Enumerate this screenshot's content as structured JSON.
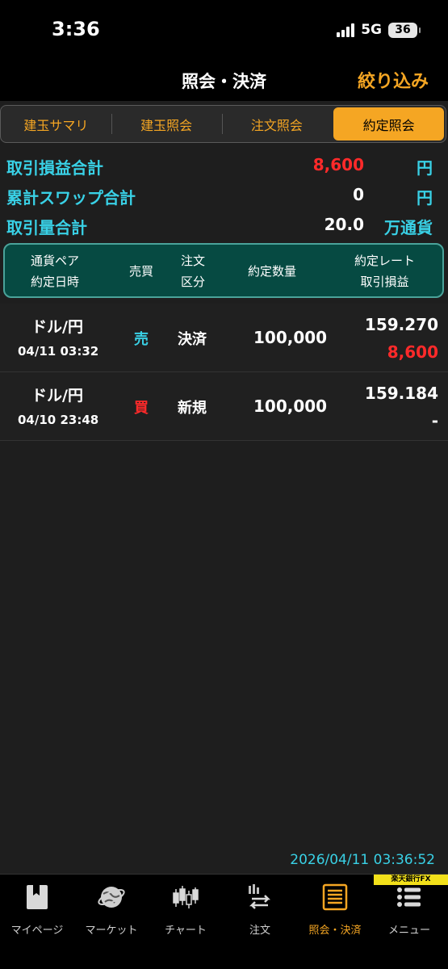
{
  "status_bar": {
    "time": "3:36",
    "network": "5G",
    "battery": "36"
  },
  "header": {
    "title": "照会・決済",
    "filter_label": "絞り込み"
  },
  "tabs": [
    {
      "label": "建玉サマリ",
      "active": false
    },
    {
      "label": "建玉照会",
      "active": false
    },
    {
      "label": "注文照会",
      "active": false
    },
    {
      "label": "約定照会",
      "active": true
    }
  ],
  "summary": {
    "pl_total": {
      "label": "取引損益合計",
      "value": "8,600",
      "unit": "円"
    },
    "swap_total": {
      "label": "累計スワップ合計",
      "value": "0",
      "unit": "円"
    },
    "volume_total": {
      "label": "取引量合計",
      "value": "20.0",
      "unit": "万通貨"
    }
  },
  "table_header": {
    "pair_line1": "通貨ペア",
    "pair_line2": "約定日時",
    "side": "売買",
    "kind_line1": "注文",
    "kind_line2": "区分",
    "qty": "約定数量",
    "rate_line1": "約定レート",
    "rate_line2": "取引損益"
  },
  "rows": [
    {
      "pair": "ドル/円",
      "datetime": "04/11 03:32",
      "side": "売",
      "kind": "決済",
      "qty": "100,000",
      "rate": "159.270",
      "pl": "8,600"
    },
    {
      "pair": "ドル/円",
      "datetime": "04/10 23:48",
      "side": "買",
      "kind": "新規",
      "qty": "100,000",
      "rate": "159.184",
      "pl": "-"
    }
  ],
  "timestamp": "2026/04/11 03:36:52",
  "brand": "楽天銀行FX",
  "nav": [
    {
      "label": "マイページ",
      "icon": "bookmark-page-icon"
    },
    {
      "label": "マーケット",
      "icon": "globe-icon"
    },
    {
      "label": "チャート",
      "icon": "candlestick-chart-icon"
    },
    {
      "label": "注文",
      "icon": "order-exchange-icon"
    },
    {
      "label": "照会・決済",
      "icon": "document-list-icon",
      "active": true
    },
    {
      "label": "メニュー",
      "icon": "menu-list-icon"
    }
  ],
  "colors": {
    "accent": "#f5a623",
    "cyan": "#39d1e6",
    "profit": "#ff2a2a",
    "sell": "#39d1e6",
    "buy": "#ff2a2a",
    "header_bg": "#064a42"
  }
}
